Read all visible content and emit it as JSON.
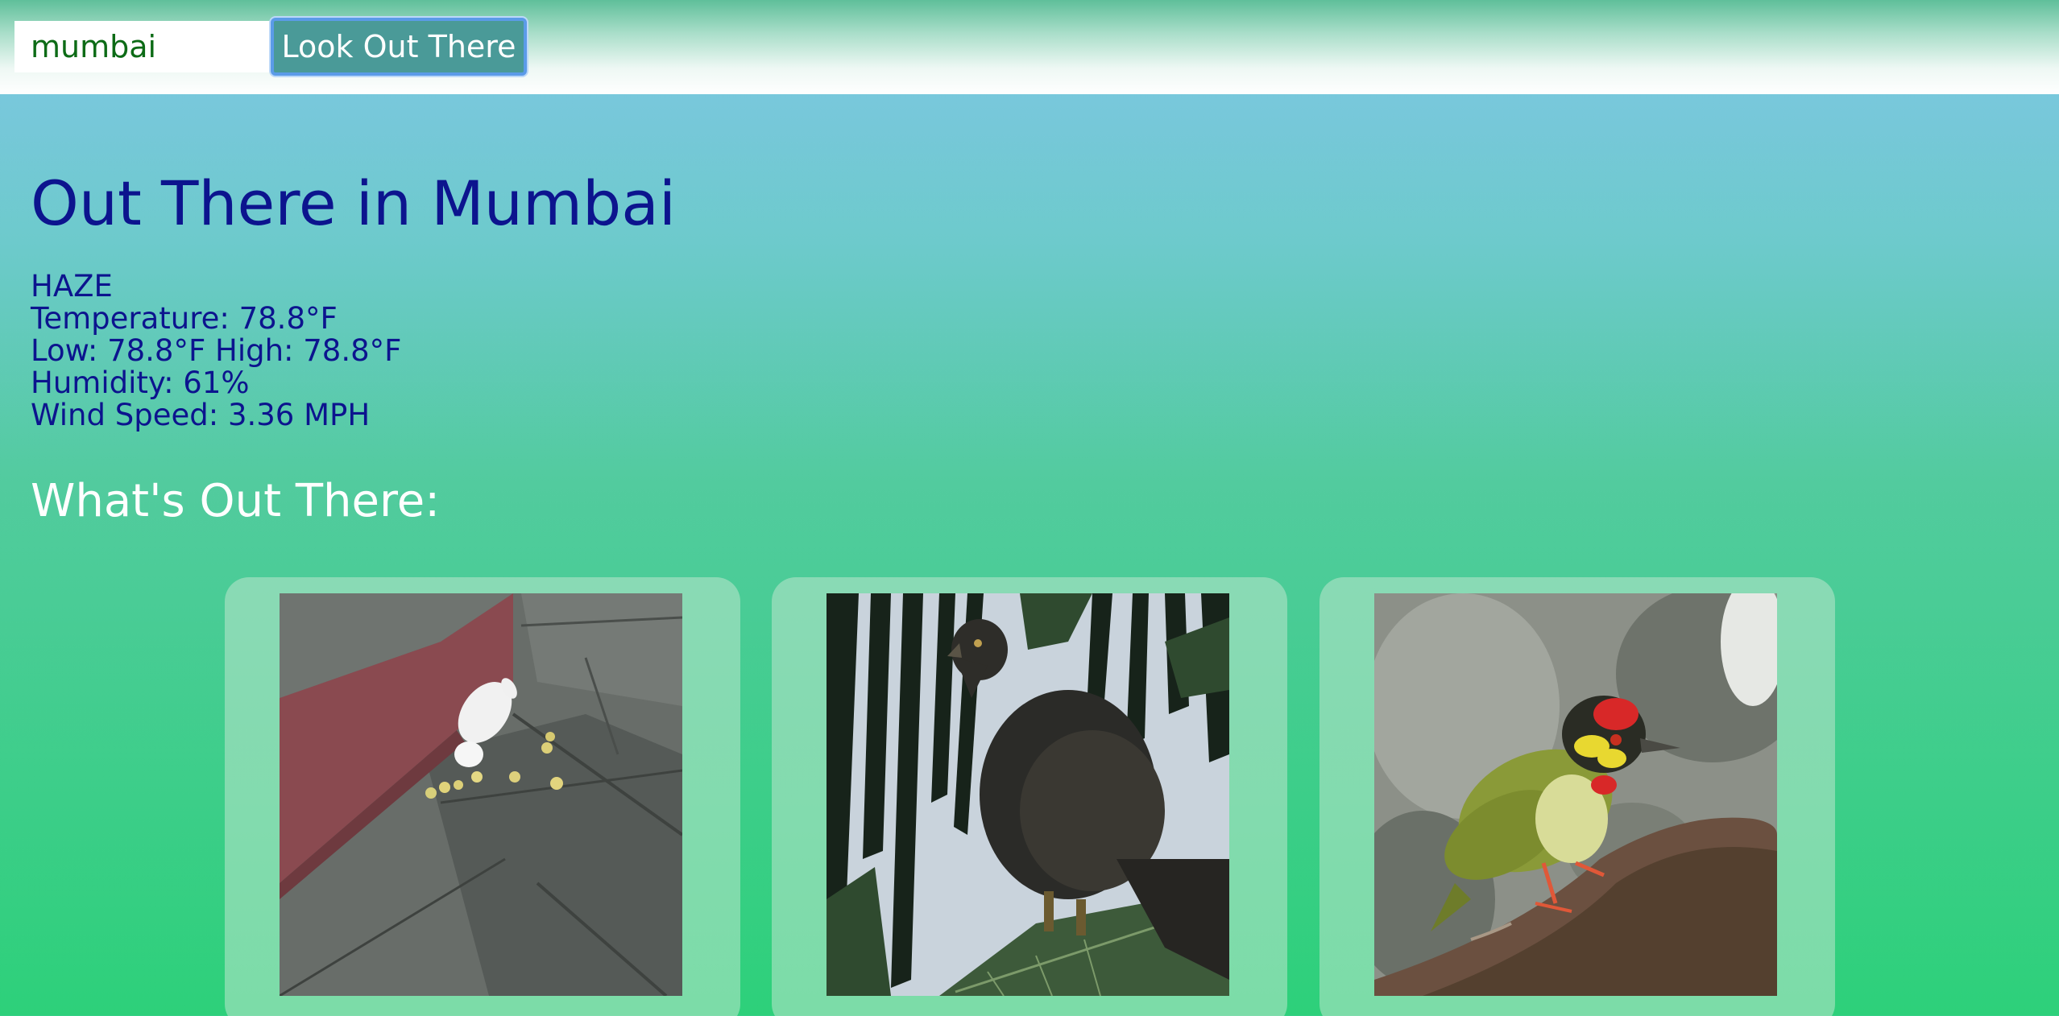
{
  "search": {
    "value": "mumbai",
    "button_label": "Look Out There"
  },
  "page_title": "Out There in Mumbai",
  "weather": {
    "condition": "HAZE",
    "temperature": "Temperature: 78.8°F",
    "low_high": "Low: 78.8°F High: 78.8°F",
    "humidity": "Humidity: 61%",
    "wind": "Wind Speed: 3.36 MPH"
  },
  "section_title": "What's Out There:",
  "cards": [
    {
      "image": "white-rabbit-photo"
    },
    {
      "image": "black-kite-photo"
    },
    {
      "image": "coppersmith-barbet-photo"
    }
  ],
  "colors": {
    "title": "#0c148e",
    "button_bg": "#4a9a98",
    "button_border": "#5b9be8",
    "input_text": "#0d6b16"
  }
}
